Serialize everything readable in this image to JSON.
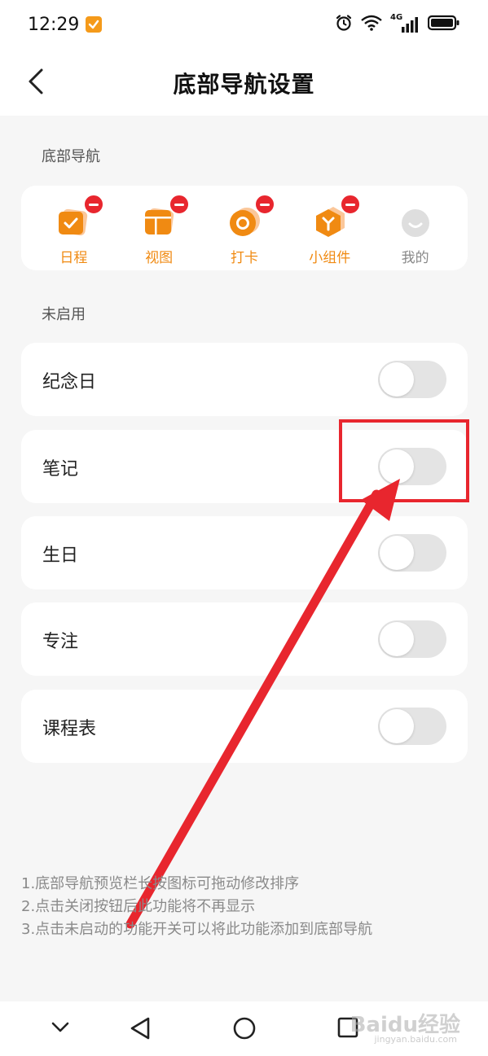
{
  "status_bar": {
    "time": "12:29",
    "network": "4G"
  },
  "header": {
    "title": "底部导航设置"
  },
  "bottom_nav_section": {
    "label": "底部导航",
    "items": [
      {
        "label": "日程",
        "icon": "calendar-check-icon",
        "enabled": true
      },
      {
        "label": "视图",
        "icon": "view-calendar-icon",
        "enabled": true
      },
      {
        "label": "打卡",
        "icon": "checkin-circle-icon",
        "enabled": true
      },
      {
        "label": "小组件",
        "icon": "widget-hexagon-icon",
        "enabled": true
      },
      {
        "label": "我的",
        "icon": "profile-smile-icon",
        "enabled": false
      }
    ]
  },
  "disabled_section": {
    "label": "未启用",
    "items": [
      {
        "label": "纪念日",
        "on": false
      },
      {
        "label": "笔记",
        "on": false
      },
      {
        "label": "生日",
        "on": false
      },
      {
        "label": "专注",
        "on": false
      },
      {
        "label": "课程表",
        "on": false
      }
    ]
  },
  "tips": [
    "1.底部导航预览栏长按图标可拖动修改排序",
    "2.点击关闭按钮后此功能将不再显示",
    "3.点击未启动的功能开关可以将此功能添加到底部导航"
  ],
  "watermark": {
    "brand": "Baidu经验",
    "sub": "jingyan.baidu.com"
  },
  "colors": {
    "accent": "#f08a12",
    "remove": "#e8262e",
    "annotation": "#e8262e"
  }
}
